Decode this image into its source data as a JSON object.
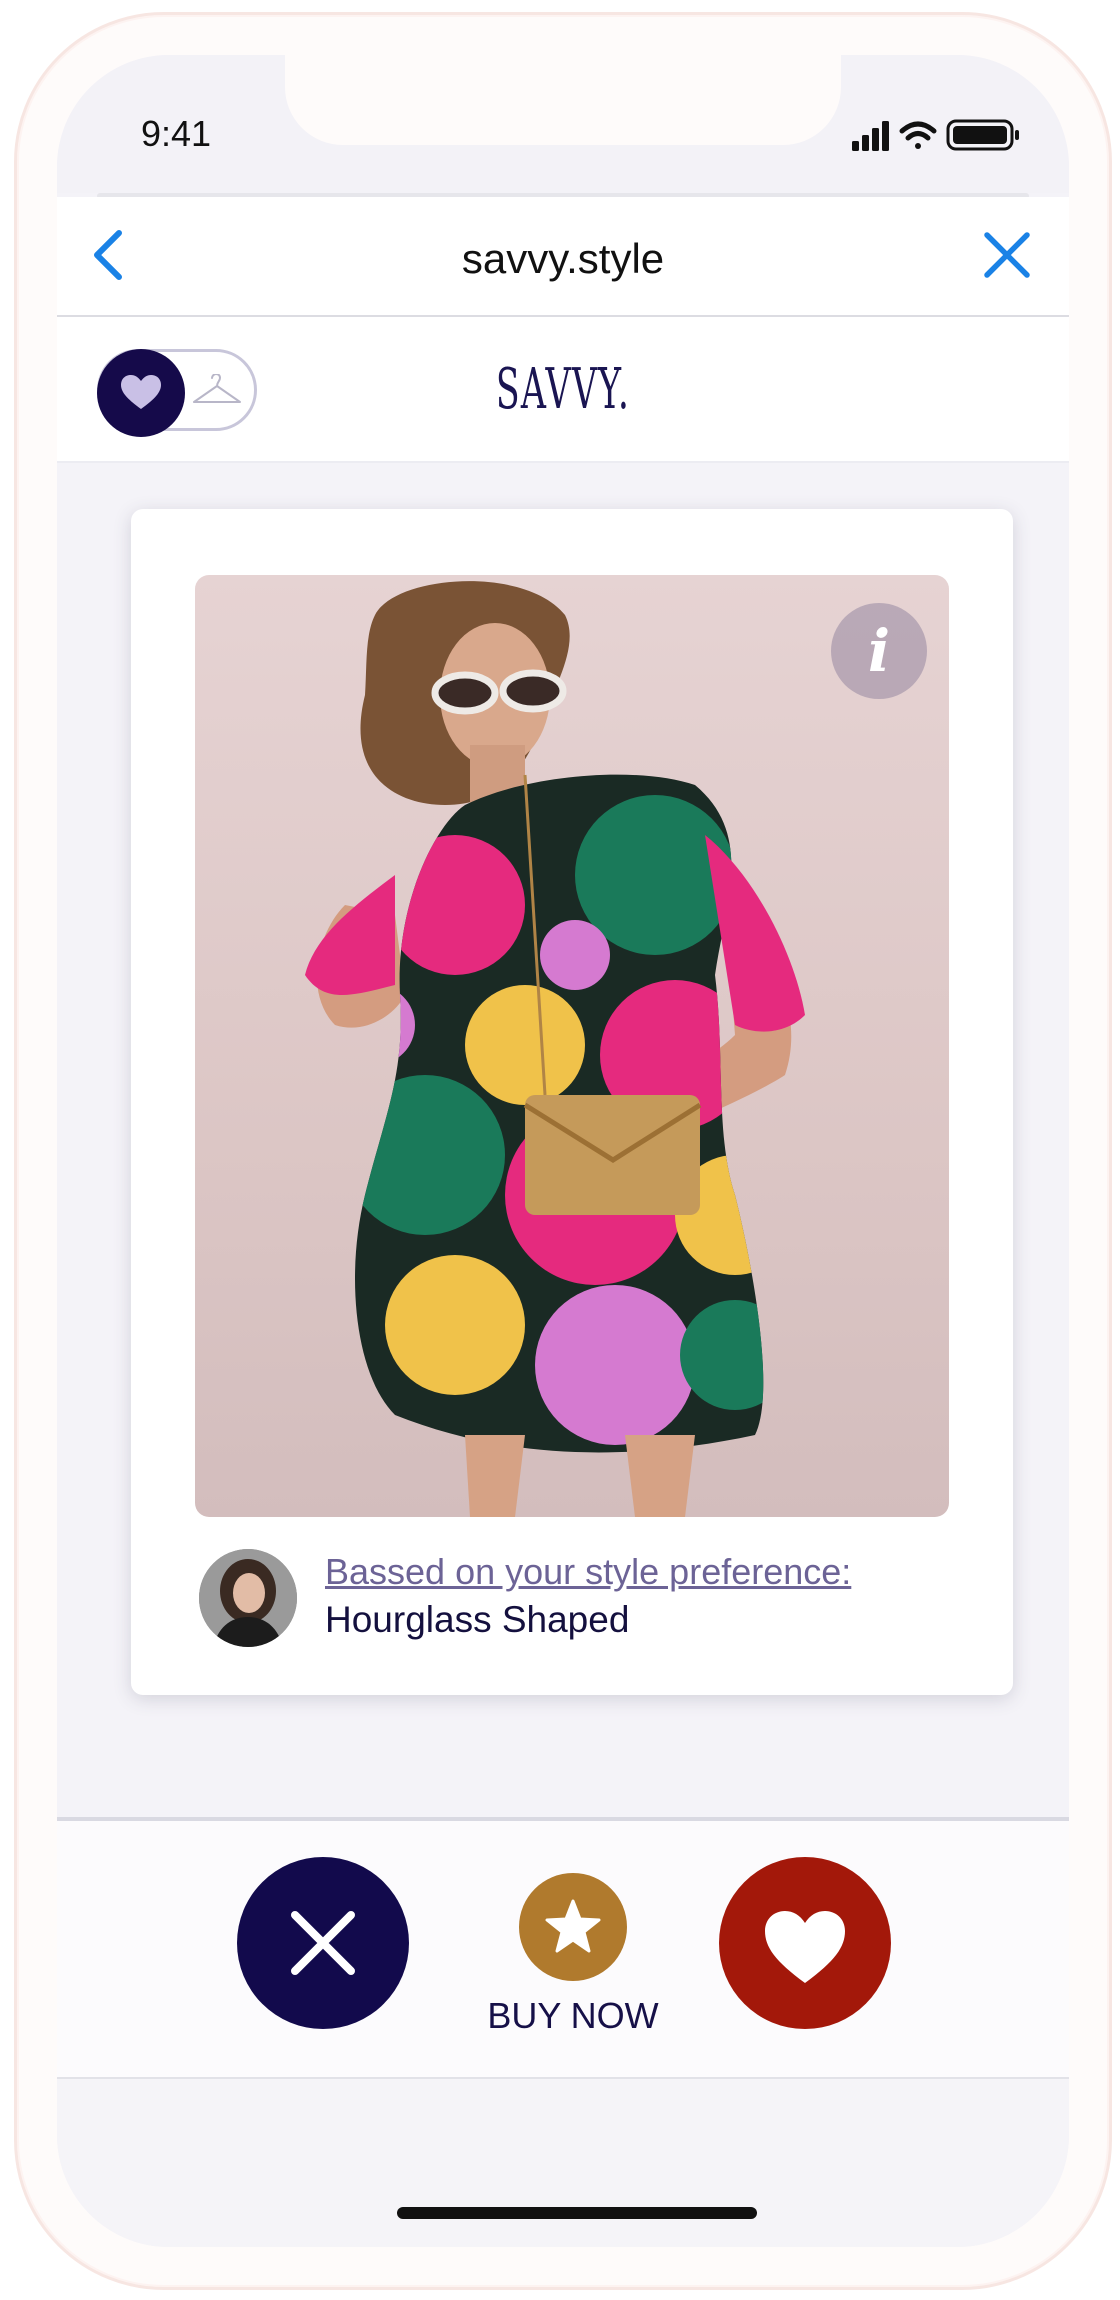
{
  "status_bar": {
    "time": "9:41"
  },
  "browser": {
    "url": "savvy.style"
  },
  "app": {
    "logo_text": "SAVVY."
  },
  "card": {
    "info_icon_glyph": "i",
    "preference_link": "Bassed on your style preference:",
    "preference_value": "Hourglass Shaped"
  },
  "actions": {
    "buy_now_label": "BUY NOW"
  },
  "colors": {
    "navy": "#120a4c",
    "gold": "#b07a2d",
    "red": "#a3180a",
    "ios_blue": "#1a82e6"
  }
}
